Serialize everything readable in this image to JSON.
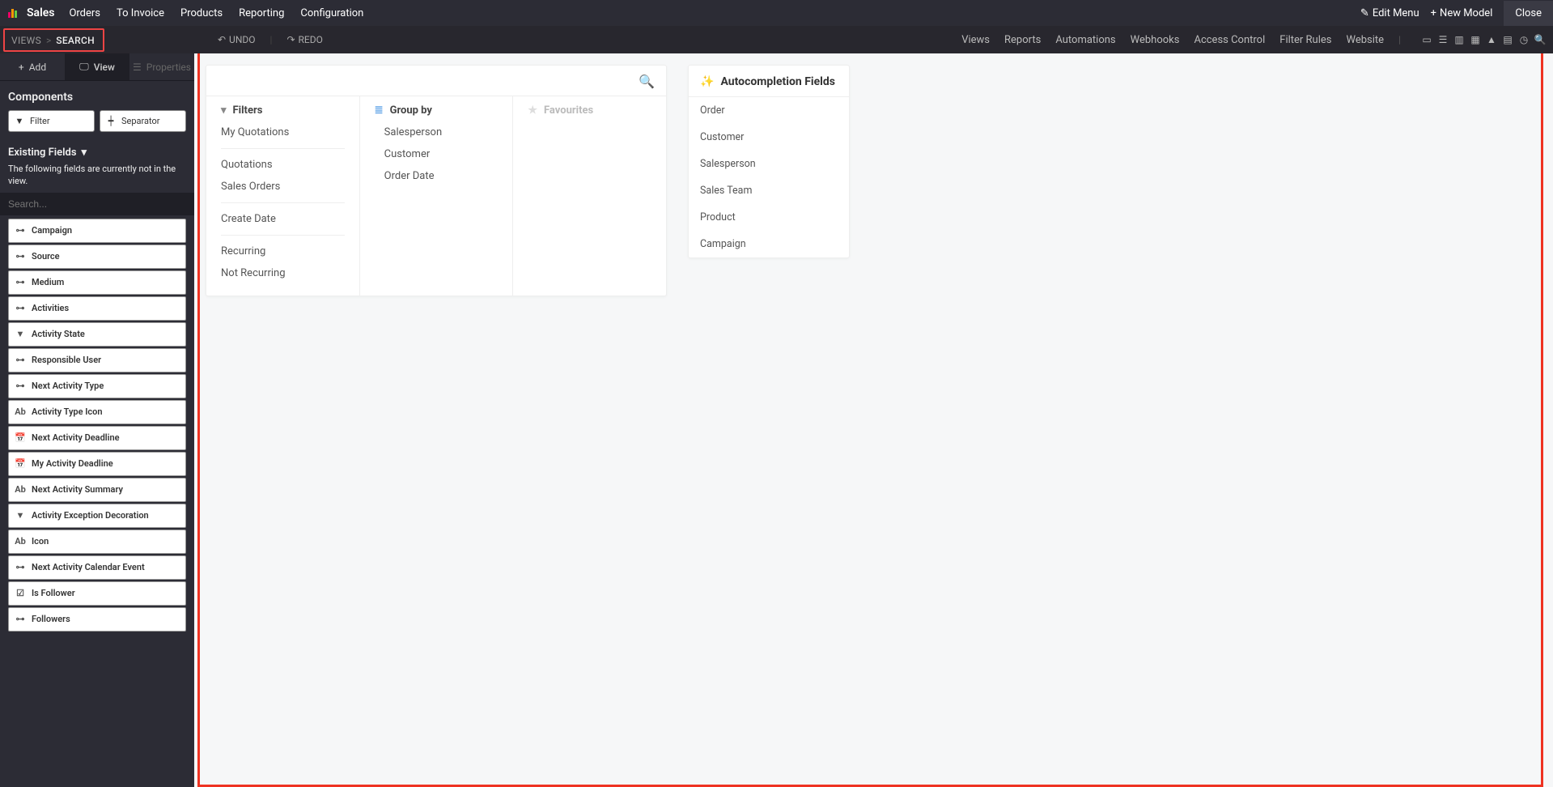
{
  "topnav": {
    "app_name": "Sales",
    "links": [
      "Orders",
      "To Invoice",
      "Products",
      "Reporting",
      "Configuration"
    ],
    "edit_menu": "Edit Menu",
    "new_model": "New Model",
    "close": "Close"
  },
  "subbar": {
    "bc_views": "VIEWS",
    "bc_sep": ">",
    "bc_search": "SEARCH",
    "undo": "UNDO",
    "redo": "REDO",
    "right_links": [
      "Views",
      "Reports",
      "Automations",
      "Webhooks",
      "Access Control",
      "Filter Rules",
      "Website"
    ]
  },
  "sidebar": {
    "tabs": {
      "add": "Add",
      "view": "View",
      "properties": "Properties"
    },
    "components_title": "Components",
    "filter_btn": "Filter",
    "separator_btn": "Separator",
    "existing_fields_title": "Existing Fields",
    "hint": "The following fields are currently not in the view.",
    "search_placeholder": "Search...",
    "fields": [
      {
        "icon": "rel",
        "label": "Campaign"
      },
      {
        "icon": "rel",
        "label": "Source"
      },
      {
        "icon": "rel",
        "label": "Medium"
      },
      {
        "icon": "rel",
        "label": "Activities"
      },
      {
        "icon": "sel",
        "label": "Activity State"
      },
      {
        "icon": "rel",
        "label": "Responsible User"
      },
      {
        "icon": "rel",
        "label": "Next Activity Type"
      },
      {
        "icon": "ab",
        "label": "Activity Type Icon"
      },
      {
        "icon": "cal",
        "label": "Next Activity Deadline"
      },
      {
        "icon": "cal",
        "label": "My Activity Deadline"
      },
      {
        "icon": "ab",
        "label": "Next Activity Summary"
      },
      {
        "icon": "sel",
        "label": "Activity Exception Decoration"
      },
      {
        "icon": "ab",
        "label": "Icon"
      },
      {
        "icon": "rel",
        "label": "Next Activity Calendar Event"
      },
      {
        "icon": "chk",
        "label": "Is Follower"
      },
      {
        "icon": "rel",
        "label": "Followers"
      }
    ]
  },
  "search_card": {
    "filters_head": "Filters",
    "filters": [
      "My Quotations",
      "Quotations",
      "Sales Orders",
      "Create Date",
      "Recurring",
      "Not Recurring"
    ],
    "groupby_head": "Group by",
    "groupby": [
      "Salesperson",
      "Customer",
      "Order Date"
    ],
    "fav_head": "Favourites"
  },
  "auto_card": {
    "head": "Autocompletion Fields",
    "items": [
      "Order",
      "Customer",
      "Salesperson",
      "Sales Team",
      "Product",
      "Campaign"
    ]
  }
}
